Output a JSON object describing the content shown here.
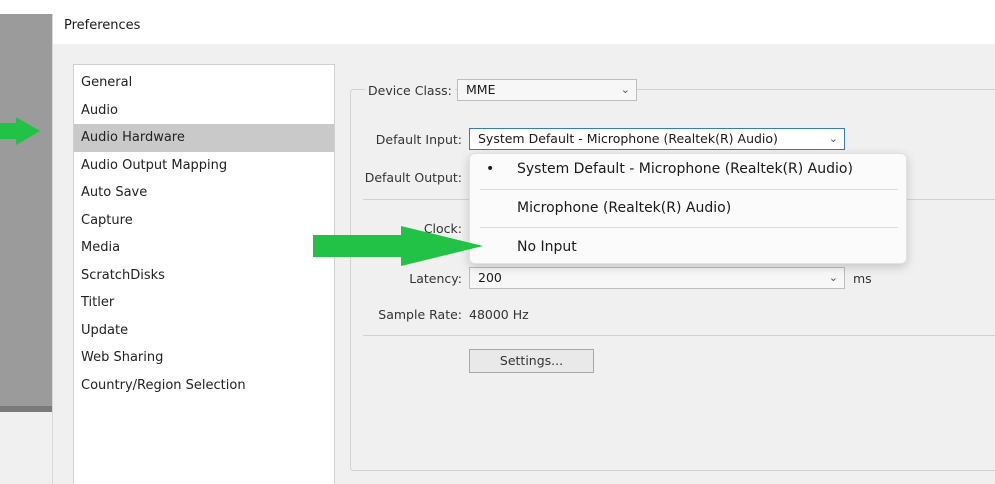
{
  "window": {
    "title": "Preferences"
  },
  "categories": [
    {
      "label": "General",
      "selected": false
    },
    {
      "label": "Audio",
      "selected": false
    },
    {
      "label": "Audio Hardware",
      "selected": true
    },
    {
      "label": "Audio Output Mapping",
      "selected": false
    },
    {
      "label": "Auto Save",
      "selected": false
    },
    {
      "label": "Capture",
      "selected": false
    },
    {
      "label": "Media",
      "selected": false
    },
    {
      "label": "ScratchDisks",
      "selected": false
    },
    {
      "label": "Titler",
      "selected": false
    },
    {
      "label": "Update",
      "selected": false
    },
    {
      "label": "Web Sharing",
      "selected": false
    },
    {
      "label": "Country/Region Selection",
      "selected": false
    }
  ],
  "audio_hardware": {
    "device_class": {
      "label": "Device Class:",
      "value": "MME"
    },
    "default_input": {
      "label": "Default Input:",
      "value": "System Default - Microphone (Realtek(R) Audio)"
    },
    "default_output": {
      "label": "Default Output:"
    },
    "clock": {
      "label": "Clock:"
    },
    "latency": {
      "label": "Latency:",
      "value": "200",
      "unit": "ms"
    },
    "sample_rate": {
      "label": "Sample Rate:",
      "value": "48000 Hz"
    },
    "settings_button": "Settings..."
  },
  "input_dropdown": {
    "options": [
      {
        "label": "System Default - Microphone (Realtek(R) Audio)",
        "selected": true
      },
      {
        "label": "Microphone (Realtek(R) Audio)",
        "selected": false
      },
      {
        "label": "No Input",
        "selected": false
      }
    ]
  },
  "icons": {
    "chevron": "chevron-down-icon",
    "bullet": "selected-bullet-icon"
  },
  "colors": {
    "annotation_arrow": "#22c247",
    "selection": "#c9c9c9",
    "focus": "#3a78c8"
  }
}
